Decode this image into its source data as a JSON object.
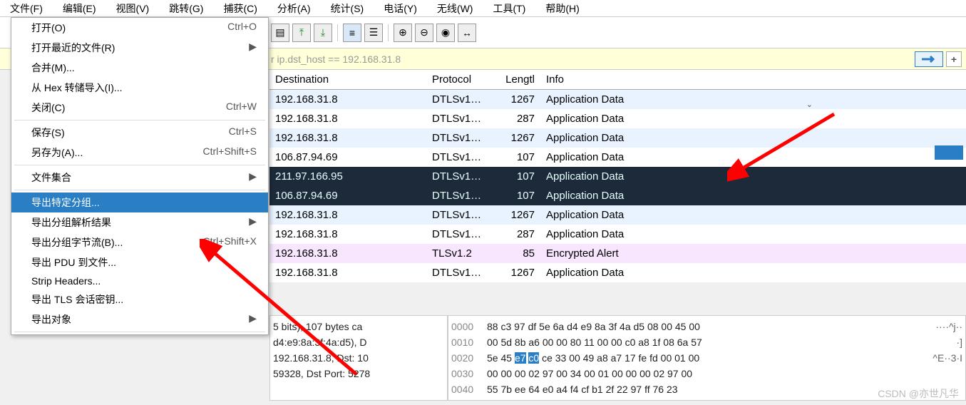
{
  "menubar": {
    "file": "文件(F)",
    "edit": "编辑(E)",
    "view": "视图(V)",
    "go": "跳转(G)",
    "capture": "捕获(C)",
    "analyze": "分析(A)",
    "stats": "统计(S)",
    "tel": "电话(Y)",
    "wireless": "无线(W)",
    "tools": "工具(T)",
    "help": "帮助(H)"
  },
  "file_menu": {
    "open": "打开(O)",
    "open_accel": "Ctrl+O",
    "open_recent": "打开最近的文件(R)",
    "merge": "合并(M)...",
    "hex_import": "从 Hex 转储导入(I)...",
    "close": "关闭(C)",
    "close_accel": "Ctrl+W",
    "save": "保存(S)",
    "save_accel": "Ctrl+S",
    "save_as": "另存为(A)...",
    "save_as_accel": "Ctrl+Shift+S",
    "file_set": "文件集合",
    "export_specified": "导出特定分组...",
    "export_dissections": "导出分组解析结果",
    "export_bytes": "导出分组字节流(B)...",
    "export_bytes_accel": "Ctrl+Shift+X",
    "export_pdu": "导出 PDU 到文件...",
    "strip_headers": "Strip Headers...",
    "export_tls": "导出 TLS 会话密钥...",
    "export_objects": "导出对象"
  },
  "filter": {
    "text": "r ip.dst_host == 192.168.31.8"
  },
  "columns": {
    "dest": "Destination",
    "proto": "Protocol",
    "len": "Lengtl",
    "info": "Info"
  },
  "rows": [
    {
      "dest": "192.168.31.8",
      "proto": "DTLSv1…",
      "len": "1267",
      "info": "Application Data",
      "cls": "bg-light"
    },
    {
      "dest": "192.168.31.8",
      "proto": "DTLSv1…",
      "len": "287",
      "info": "Application Data",
      "cls": "bg-white"
    },
    {
      "dest": "192.168.31.8",
      "proto": "DTLSv1…",
      "len": "1267",
      "info": "Application Data",
      "cls": "bg-light"
    },
    {
      "dest": "106.87.94.69",
      "proto": "DTLSv1…",
      "len": "107",
      "info": "Application Data",
      "cls": "bg-white"
    },
    {
      "dest": "211.97.166.95",
      "proto": "DTLSv1…",
      "len": "107",
      "info": "Application Data",
      "cls": "bg-dark"
    },
    {
      "dest": "106.87.94.69",
      "proto": "DTLSv1…",
      "len": "107",
      "info": "Application Data",
      "cls": "bg-dark"
    },
    {
      "dest": "192.168.31.8",
      "proto": "DTLSv1…",
      "len": "1267",
      "info": "Application Data",
      "cls": "bg-light"
    },
    {
      "dest": "192.168.31.8",
      "proto": "DTLSv1…",
      "len": "287",
      "info": "Application Data",
      "cls": "bg-white"
    },
    {
      "dest": "192.168.31.8",
      "proto": "TLSv1.2",
      "len": "85",
      "info": "Encrypted Alert",
      "cls": "bg-pink"
    },
    {
      "dest": "192.168.31.8",
      "proto": "DTLSv1…",
      "len": "1267",
      "info": "Application Data",
      "cls": "bg-white"
    }
  ],
  "details": {
    "l1": "5 bits), 107 bytes ca",
    "l2": "d4:e9:8a:3f:4a:d5), D",
    "l3": "192.168.31.8, Dst: 10",
    "l4": "59328, Dst Port: 5278"
  },
  "hex": [
    {
      "off": "0000",
      "b": "88 c3 97 df 5e 6a d4 e9  8a 3f 4a d5 08 00 45 00",
      "a": "····^j··"
    },
    {
      "off": "0010",
      "b": "00 5d 8b a6 00 00 80 11  00 00 c0 a8 1f 08 6a 57",
      "a": "·]"
    },
    {
      "off": "0020",
      "b": "5e 45 e7 c0 ce 33 00 49  a8 a7 17 fe fd 00 01 00",
      "a": "^E··3·I",
      "hl": [
        6,
        11
      ]
    },
    {
      "off": "0030",
      "b": "00 00 00 02 97 00 34 00  01 00 00 00 02 97 00",
      "a": ""
    },
    {
      "off": "0040",
      "b": "55 7b ee 64 e0 a4 f4 cf  b1 2f 22 97 ff 76 23",
      "a": ""
    }
  ],
  "watermark": "CSDN @亦世凡华"
}
